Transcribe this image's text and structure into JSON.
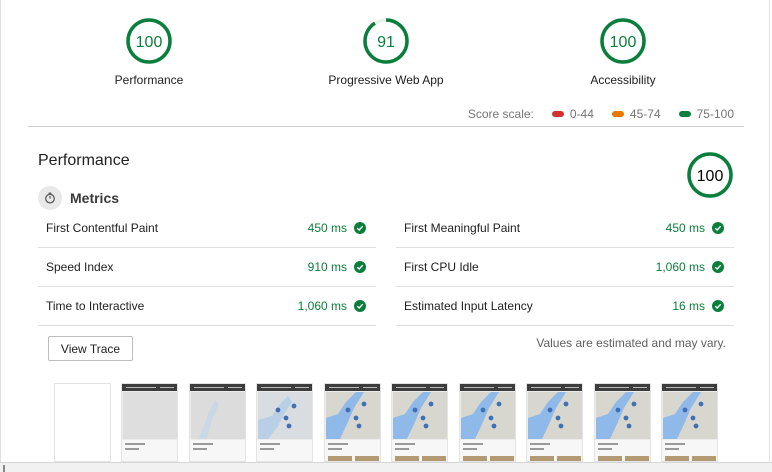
{
  "gauges": [
    {
      "score": "100",
      "label": "Performance",
      "fraction": 1.0
    },
    {
      "score": "91",
      "label": "Progressive Web App",
      "fraction": 0.91
    },
    {
      "score": "100",
      "label": "Accessibility",
      "fraction": 1.0
    }
  ],
  "score_scale": {
    "label": "Score scale:",
    "ranges": [
      {
        "text": "0-44",
        "color": "#d32f2f"
      },
      {
        "text": "45-74",
        "color": "#e67700"
      },
      {
        "text": "75-100",
        "color": "#0a7e3b"
      }
    ]
  },
  "performance": {
    "title": "Performance",
    "score": "100",
    "fraction": 1.0,
    "metrics_heading": "Metrics",
    "metrics_left": [
      {
        "name": "First Contentful Paint",
        "value": "450 ms"
      },
      {
        "name": "Speed Index",
        "value": "910 ms"
      },
      {
        "name": "Time to Interactive",
        "value": "1,060 ms"
      }
    ],
    "metrics_right": [
      {
        "name": "First Meaningful Paint",
        "value": "450 ms"
      },
      {
        "name": "First CPU Idle",
        "value": "1,060 ms"
      },
      {
        "name": "Estimated Input Latency",
        "value": "16 ms"
      }
    ],
    "view_trace_label": "View Trace",
    "estimate_note": "Values are estimated and may vary."
  },
  "colors": {
    "pass": "#0a7e3b",
    "map_water": "#8fb9e8",
    "map_land": "#d7d7cf",
    "pin": "#3f6fb5"
  }
}
